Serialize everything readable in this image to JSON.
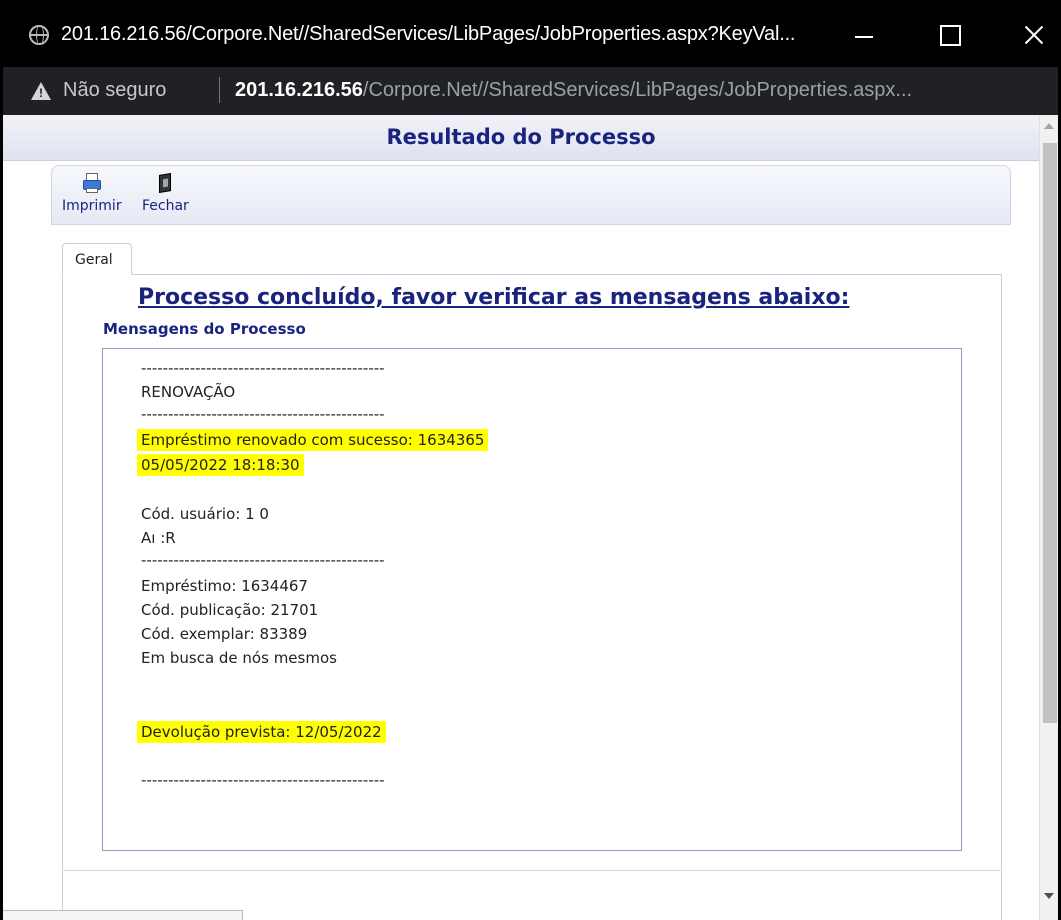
{
  "window": {
    "title": "201.16.216.56/Corpore.Net//SharedServices/LibPages/JobProperties.aspx?KeyVal...",
    "minimize_icon": "minimize-icon",
    "maximize_icon": "maximize-icon",
    "close_icon": "close-icon"
  },
  "address_bar": {
    "security_label": "Não seguro",
    "host": "201.16.216.56",
    "path": "/Corpore.Net//SharedServices/LibPages/JobProperties.aspx..."
  },
  "page": {
    "header_title": "Resultado do Processo",
    "toolbar": {
      "print_label": "Imprimir",
      "close_label": "Fechar"
    },
    "tabs": [
      {
        "label": "Geral"
      }
    ],
    "conclusion_text": "Processo concluído, favor verificar as mensagens abaixo:",
    "messages_label": "Mensagens do Processo",
    "messages": {
      "dash_line": "---------------------------------------------",
      "section_title": "RENOVAÇÃO",
      "renewed_line": "Empréstimo renovado com sucesso: 1634365",
      "renewed_datetime": "05/05/2022 18:18:30",
      "user_code": "Cód. usuário: 1          0",
      "user_name": "Aı                                          :R",
      "loan": "Empréstimo: 1634467",
      "publication_code": "Cód. publicação: 21701",
      "copy_code": "Cód. exemplar: 83389",
      "book_title": "Em busca de nós mesmos",
      "due_date": "Devolução prevista: 12/05/2022"
    }
  },
  "colors": {
    "accent": "#1a237e",
    "highlight": "#ffff00",
    "titlebar": "#000000",
    "addressbar": "#202124"
  }
}
